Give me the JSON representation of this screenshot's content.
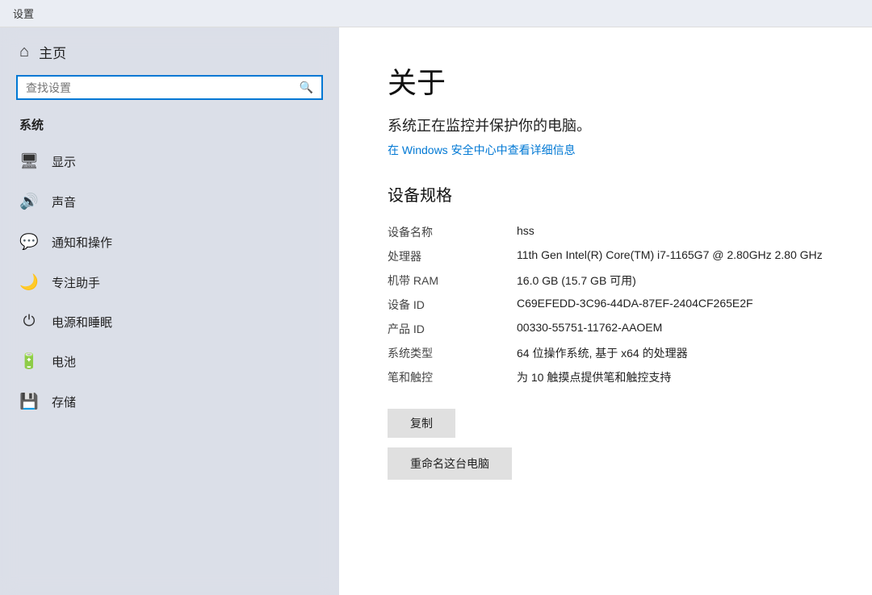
{
  "topbar": {
    "title": "设置"
  },
  "sidebar": {
    "home_label": "主页",
    "search_placeholder": "查找设置",
    "section_title": "系统",
    "items": [
      {
        "id": "display",
        "label": "显示",
        "icon": "🖥"
      },
      {
        "id": "sound",
        "label": "声音",
        "icon": "🔊"
      },
      {
        "id": "notifications",
        "label": "通知和操作",
        "icon": "💬"
      },
      {
        "id": "focus",
        "label": "专注助手",
        "icon": "🌙"
      },
      {
        "id": "power",
        "label": "电源和睡眠",
        "icon": "⏻"
      },
      {
        "id": "battery",
        "label": "电池",
        "icon": "🔋"
      },
      {
        "id": "storage",
        "label": "存储",
        "icon": "💾"
      }
    ]
  },
  "content": {
    "page_title": "关于",
    "protection_status": "系统正在监控并保护你的电脑。",
    "security_link": "在 Windows 安全中心中查看详细信息",
    "specs_title": "设备规格",
    "specs": [
      {
        "label": "设备名称",
        "value": "hss"
      },
      {
        "label": "处理器",
        "value": "11th Gen Intel(R) Core(TM) i7-1165G7 @ 2.80GHz 2.80 GHz"
      },
      {
        "label": "机带 RAM",
        "value": "16.0 GB (15.7 GB 可用)"
      },
      {
        "label": "设备 ID",
        "value": "C69EFEDD-3C96-44DA-87EF-2404CF265E2F"
      },
      {
        "label": "产品 ID",
        "value": "00330-55751-11762-AAOEM"
      },
      {
        "label": "系统类型",
        "value": "64 位操作系统, 基于 x64 的处理器"
      },
      {
        "label": "笔和触控",
        "value": "为 10 触摸点提供笔和触控支持"
      }
    ],
    "copy_button": "复制",
    "rename_button": "重命名这台电脑"
  }
}
